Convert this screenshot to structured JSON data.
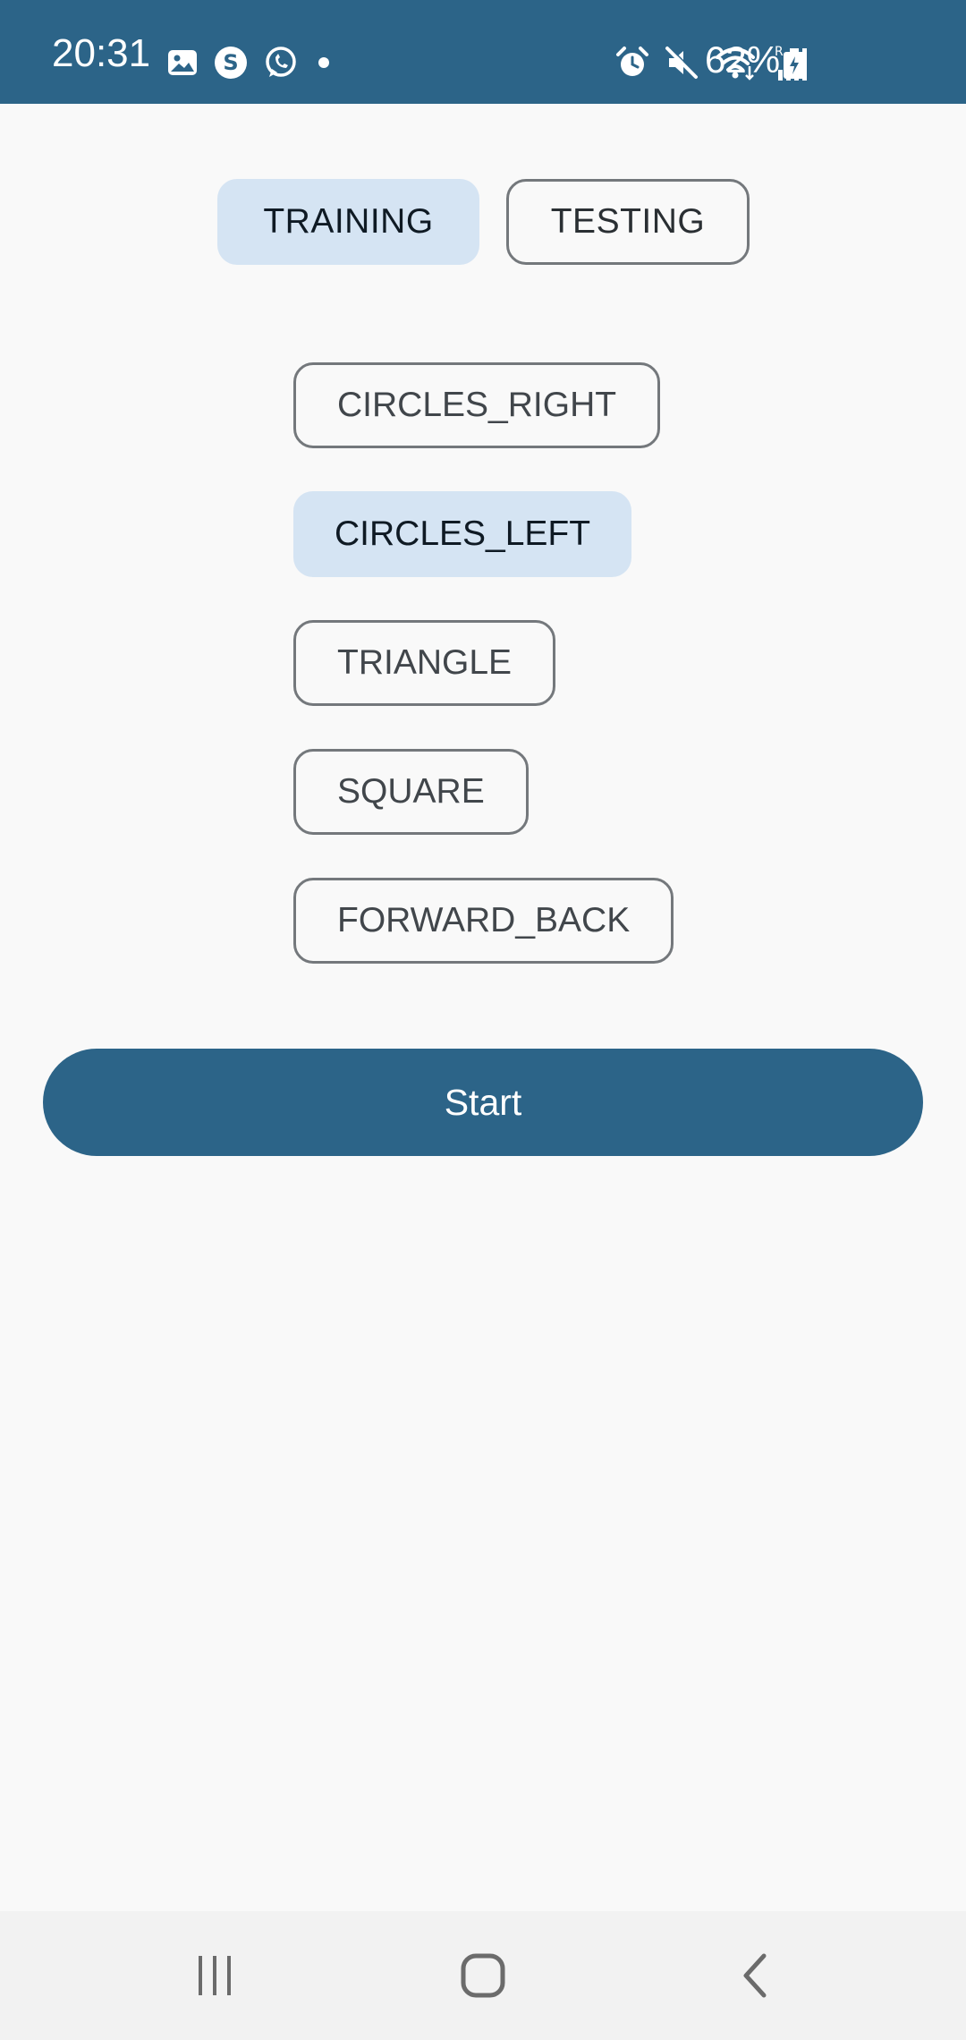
{
  "status_bar": {
    "time": "20:31",
    "battery_percent": "62%",
    "background": "#2c6488",
    "left_icons": [
      "gallery-icon",
      "skype-icon",
      "whatsapp-icon",
      "notification-dot-icon"
    ],
    "right_icons": [
      "alarm-icon",
      "mute-icon",
      "wifi-icon",
      "signal-icon",
      "battery-charging-icon"
    ]
  },
  "mode": {
    "options": [
      {
        "label": "TRAINING",
        "selected": true
      },
      {
        "label": "TESTING",
        "selected": false
      }
    ]
  },
  "shapes": {
    "options": [
      {
        "label": "CIRCLES_RIGHT",
        "selected": false
      },
      {
        "label": "CIRCLES_LEFT",
        "selected": true
      },
      {
        "label": "TRIANGLE",
        "selected": false
      },
      {
        "label": "SQUARE",
        "selected": false
      },
      {
        "label": "FORWARD_BACK",
        "selected": false
      }
    ]
  },
  "start_button": {
    "label": "Start"
  },
  "nav_bar": {
    "items": [
      "recent-apps-icon",
      "home-icon",
      "back-icon"
    ]
  },
  "colors": {
    "primary": "#2c6488",
    "selected_chip": "#d5e4f3",
    "outline": "#74787c",
    "background": "#f9f9f9"
  }
}
